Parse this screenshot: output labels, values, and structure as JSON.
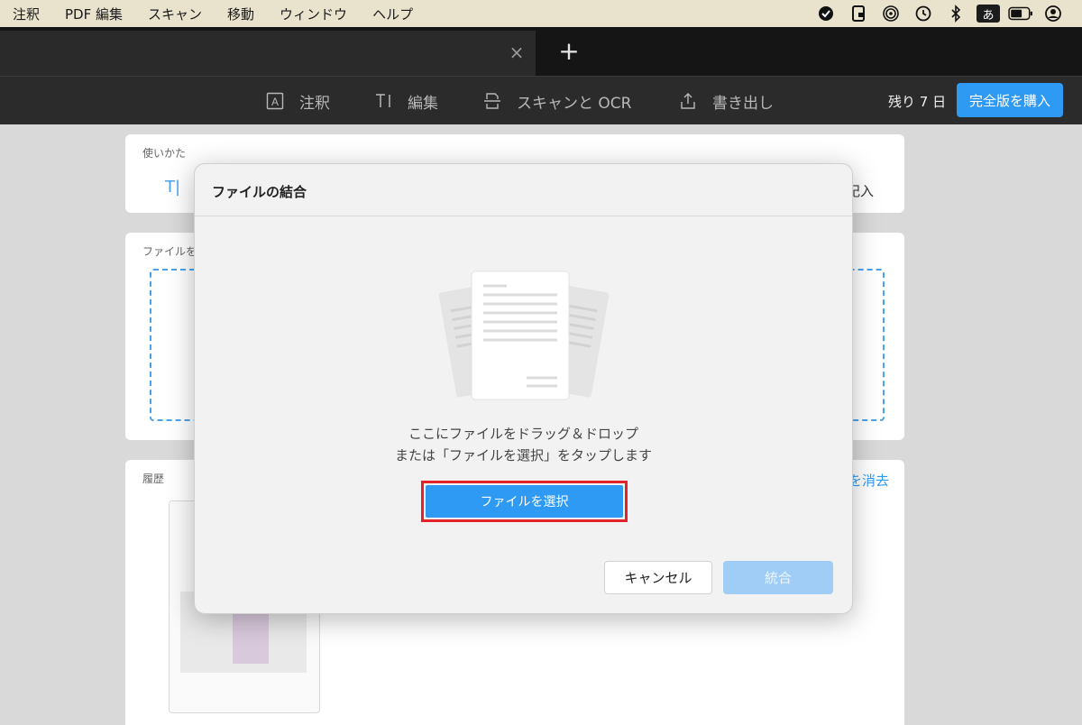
{
  "menubar": {
    "items": [
      "注釈",
      "PDF 編集",
      "スキャン",
      "移動",
      "ウィンドウ",
      "ヘルプ"
    ],
    "status_icons": [
      "checkmark-badge-icon",
      "document-lock-icon",
      "airplay-icon",
      "time-machine-icon",
      "bluetooth-icon",
      "input-method-icon",
      "battery-icon",
      "user-account-icon"
    ],
    "ime_label": "あ"
  },
  "tabs": {
    "close_glyph": "×",
    "add_glyph": "+"
  },
  "toolbar": {
    "tools": [
      {
        "label": "注釈",
        "icon": "annotate-icon"
      },
      {
        "label": "編集",
        "icon": "edit-text-icon"
      },
      {
        "label": "スキャンと OCR",
        "icon": "scan-icon"
      },
      {
        "label": "書き出し",
        "icon": "export-icon"
      }
    ],
    "trial_remaining": "残り 7 日",
    "buy_label": "完全版を購入"
  },
  "background": {
    "howto_label": "使いかた",
    "howto_fragment_right": "記入",
    "files_label": "ファイルを",
    "history_label": "履歴",
    "history_clear_fragment": "を消去"
  },
  "modal": {
    "title": "ファイルの結合",
    "drop_line1": "ここにファイルをドラッグ＆ドロップ",
    "drop_line2": "または「ファイルを選択」をタップします",
    "choose_label": "ファイルを選択",
    "cancel_label": "キャンセル",
    "merge_label": "統合"
  },
  "colors": {
    "accent": "#2f9af3",
    "highlight": "#e2232c",
    "menubar": "#e9e2cd"
  }
}
